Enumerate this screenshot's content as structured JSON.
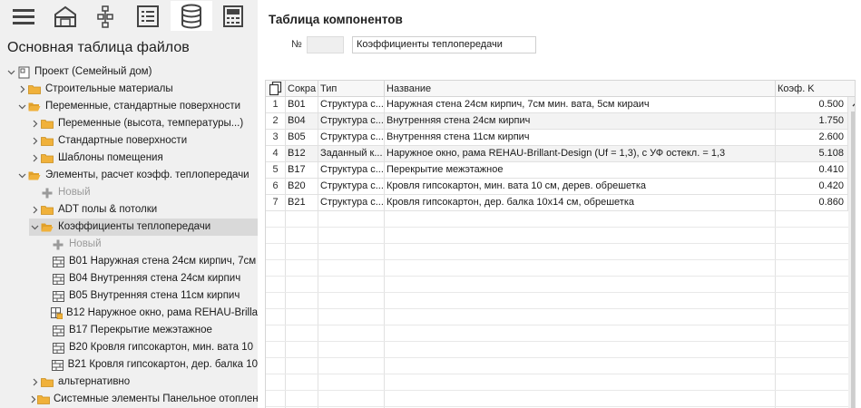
{
  "left_pane": {
    "title": "Основная таблица файлов",
    "toolbar": [
      "menu-icon",
      "house-icon",
      "structure-tree-icon",
      "list-icon",
      "database-icon",
      "calculator-icon"
    ],
    "tree": [
      {
        "label": "Проект (Семейный дом)",
        "expanded": true,
        "icon": "project-icon"
      },
      {
        "label": "Строительные материалы",
        "expanded": false,
        "icon": "folder-icon"
      },
      {
        "label": "Переменные, стандартные поверхности",
        "expanded": true,
        "icon": "folder-icon"
      },
      {
        "label": "Переменные (высота, температуры...)",
        "expanded": false,
        "icon": "folder-icon"
      },
      {
        "label": "Стандартные поверхности",
        "expanded": false,
        "icon": "folder-icon"
      },
      {
        "label": "Шаблоны помещения",
        "expanded": false,
        "icon": "folder-icon"
      },
      {
        "label": "Элементы, расчет коэфф. теплопередачи",
        "expanded": true,
        "icon": "folder-icon"
      },
      {
        "label": "Новый",
        "icon": "plus-icon"
      },
      {
        "label": "ADT полы & потолки",
        "expanded": false,
        "icon": "folder-icon"
      },
      {
        "label": "Коэффициенты теплопередачи",
        "expanded": true,
        "icon": "folder-icon"
      },
      {
        "label": "Новый",
        "icon": "plus-icon"
      },
      {
        "label": "B01 Наружная стена 24см кирпич, 7см",
        "icon": "wall-structure-icon"
      },
      {
        "label": "B04 Внутренняя стена 24см кирпич",
        "icon": "wall-structure-icon"
      },
      {
        "label": "B05 Внутренняя стена 11см кирпич",
        "icon": "wall-structure-icon"
      },
      {
        "label": "B12 Наружное окно, рама REHAU-Brilla",
        "icon": "window-lock-icon"
      },
      {
        "label": "B17 Перекрытие межэтажное",
        "icon": "wall-structure-icon"
      },
      {
        "label": "B20 Кровля гипсокартон, мин. вата 10",
        "icon": "wall-structure-icon"
      },
      {
        "label": "B21 Кровля гипсокартон, дер. балка 10",
        "icon": "wall-structure-icon"
      },
      {
        "label": "альтернативно",
        "expanded": false,
        "icon": "folder-icon"
      },
      {
        "label": "Системные элементы Панельное отоплен",
        "expanded": false,
        "icon": "folder-icon"
      }
    ]
  },
  "main": {
    "title": "Таблица компонентов",
    "number_label": "№",
    "number_value": "",
    "name_value": "Коэффициенты теплопередачи",
    "table": {
      "copy_icon": "copy-icon",
      "columns": [
        "Сокра",
        "Тип",
        "Название",
        "Коэф. K"
      ],
      "rows": [
        {
          "n": "1",
          "abbr": "B01",
          "type": "Структура с...",
          "name": "Наружная стена 24см кирпич, 7см мин. вата, 5см кираич",
          "k": "0.500"
        },
        {
          "n": "2",
          "abbr": "B04",
          "type": "Структура с...",
          "name": "Внутренняя стена 24см кирпич",
          "k": "1.750"
        },
        {
          "n": "3",
          "abbr": "B05",
          "type": "Структура с...",
          "name": "Внутренняя стена 11см кирпич",
          "k": "2.600"
        },
        {
          "n": "4",
          "abbr": "B12",
          "type": "Заданный к...",
          "name": "Наружное окно, рама REHAU-Brillant-Design (Uf = 1,3), с УФ остекл. = 1,3",
          "k": "5.108"
        },
        {
          "n": "5",
          "abbr": "B17",
          "type": "Структура с...",
          "name": "Перекрытие межэтажное",
          "k": "0.410"
        },
        {
          "n": "6",
          "abbr": "B20",
          "type": "Структура с...",
          "name": "Кровля гипсокартон, мин. вата 10 см, дерев. обрешетка",
          "k": "0.420"
        },
        {
          "n": "7",
          "abbr": "B21",
          "type": "Структура с...",
          "name": "Кровля гипсокартон, дер. балка 10x14 см, обрешетка",
          "k": "0.860"
        }
      ]
    }
  },
  "colors": {
    "folder": "#f0b13a",
    "selection": "#d9d9d9",
    "pane_bg": "#f0f0f0"
  }
}
